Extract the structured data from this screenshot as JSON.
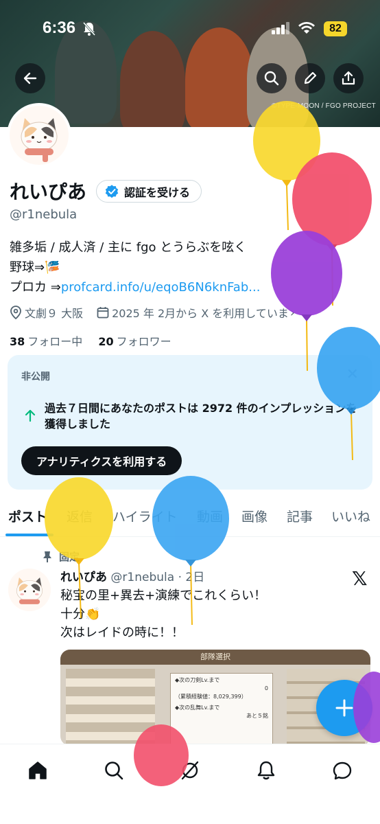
{
  "status_bar": {
    "time": "6:36",
    "battery": "82"
  },
  "banner": {
    "credit": "©TYPE-MOON / FGO PROJECT"
  },
  "profile": {
    "name": "れいぴあ",
    "verify_label": "認証を受ける",
    "handle": "@r1nebula",
    "bio_line1": "雑多垢 / 成人済 / 主に fgo とうらぶを呟く",
    "bio_line2": "野球⇒🎏",
    "bio_line3_prefix": "プロカ ⇒",
    "bio_link": "profcard.info/u/eqoB6N6knFab...",
    "location": "文劇９ 大阪",
    "joined": "2025 年 2月から X を利用していま",
    "following_count": "38",
    "following_label": "フォロー中",
    "followers_count": "20",
    "followers_label": "フォロワー"
  },
  "private_card": {
    "label": "非公開",
    "message": "過去７日間にあなたのポストは 2972 件のインプレッションを獲得しました",
    "cta": "アナリティクスを利用する"
  },
  "tabs": [
    "ポスト",
    "返信",
    "ハイライト",
    "動画",
    "画像",
    "記事",
    "いいね"
  ],
  "pinned_post": {
    "pinned_label": "固定",
    "author": "れいぴあ",
    "handle": "@r1nebula",
    "time": "2日",
    "line1": "秘宝の里+異去+演練でこれくらい！",
    "line2": "十分👏",
    "line3": "次はレイドの時に！！",
    "image_title": "部隊選択",
    "image_rows": [
      {
        "label": "◆次の刀剣Lv.まで",
        "value": "0",
        "extra": "（累積経験値：8,029,399）"
      },
      {
        "label": "◆次の乱舞Lv.まで",
        "value": "あと５銘"
      }
    ]
  },
  "colors": {
    "accent": "#1d9bf0",
    "text": "#0f1419",
    "muted": "#536471",
    "card_bg": "#e7f5fd"
  }
}
